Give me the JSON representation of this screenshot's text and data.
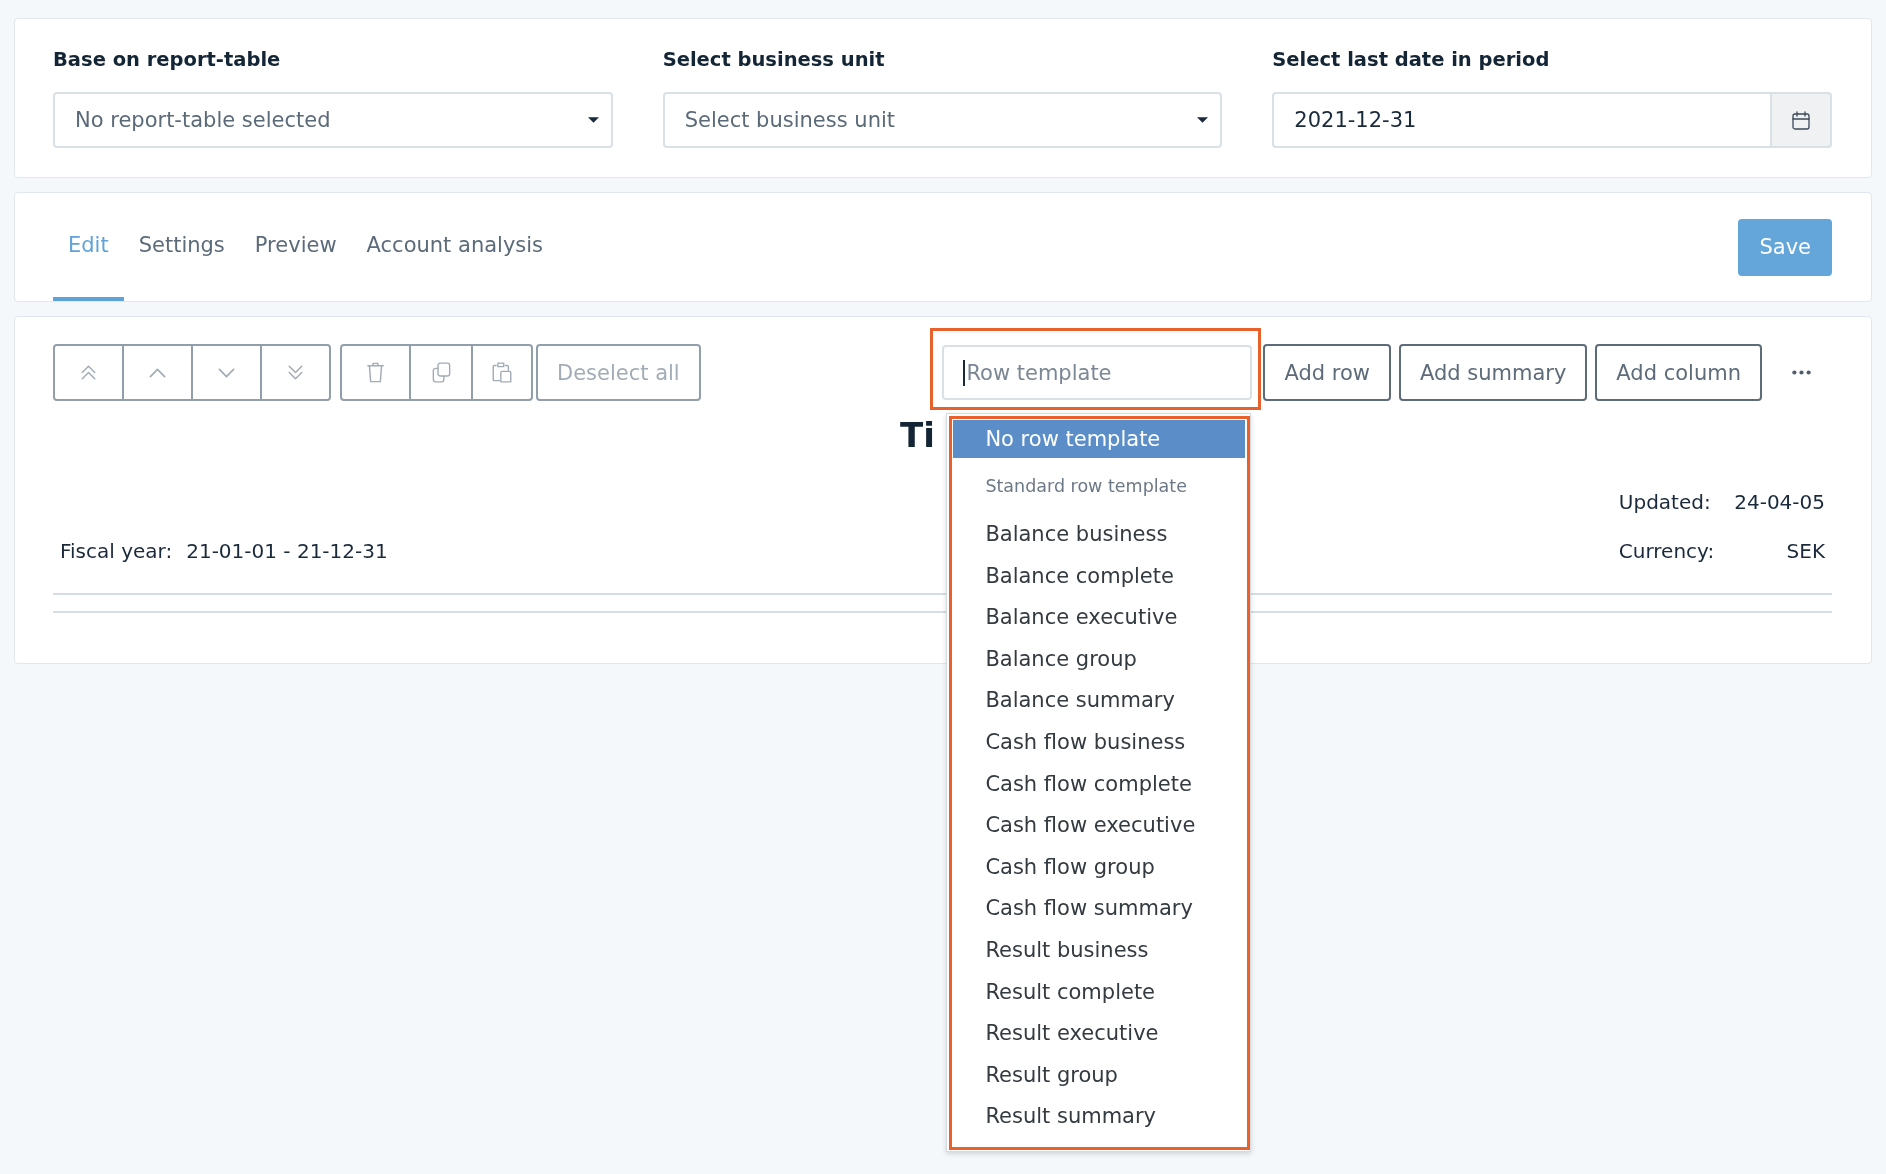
{
  "filters": [
    {
      "kind": "select",
      "label": "Base on report-table",
      "value": "No report-table selected"
    },
    {
      "kind": "select",
      "label": "Select business unit",
      "placeholder": "Select business unit"
    },
    {
      "kind": "date",
      "label": "Select last date in period",
      "value": "2021-12-31"
    }
  ],
  "tabs": [
    {
      "label": "Edit",
      "selected": true
    },
    {
      "label": "Settings",
      "selected": false
    },
    {
      "label": "Preview",
      "selected": false
    },
    {
      "label": "Account analysis",
      "selected": false
    }
  ],
  "save_button": {
    "label": "Save"
  },
  "toolbar": {
    "edit_groups": [
      {
        "buttons": [
          {
            "kind": "move-top",
            "disabled": true
          },
          {
            "kind": "move-up",
            "disabled": true
          },
          {
            "kind": "move-down",
            "disabled": true
          },
          {
            "kind": "move-bottom",
            "disabled": true
          }
        ]
      },
      {
        "buttons": [
          {
            "kind": "delete",
            "disabled": true
          },
          {
            "kind": "copy",
            "disabled": true
          },
          {
            "kind": "paste",
            "disabled": true
          }
        ]
      }
    ],
    "deselect_button": {
      "label": "Deselect all",
      "disabled": true
    },
    "row_template": {
      "placeholder": "Row template",
      "focused": true,
      "highlighted": true
    },
    "action_buttons": [
      {
        "label": "Add row",
        "disabled": false
      },
      {
        "label": "Add summary",
        "disabled": false
      },
      {
        "label": "Add column",
        "disabled": false
      }
    ]
  },
  "report": {
    "title": "Ti",
    "fiscal_year": {
      "label": "Fiscal year:",
      "value": "21-01-01 - 21-12-31"
    },
    "details": [
      {
        "label": "Updated:",
        "value": "24-04-05"
      },
      {
        "label": "Currency:",
        "value": "SEK"
      }
    ]
  },
  "row_template_menu": {
    "highlighted": true,
    "options": [
      {
        "label": "No row template",
        "selected": true
      }
    ],
    "groups": [
      {
        "label": "Standard row template",
        "options": [
          {
            "label": "Balance business",
            "selected": false
          },
          {
            "label": "Balance complete",
            "selected": false
          },
          {
            "label": "Balance executive",
            "selected": false
          },
          {
            "label": "Balance group",
            "selected": false
          },
          {
            "label": "Balance summary",
            "selected": false
          },
          {
            "label": "Cash flow business",
            "selected": false
          },
          {
            "label": "Cash flow complete",
            "selected": false
          },
          {
            "label": "Cash flow executive",
            "selected": false
          },
          {
            "label": "Cash flow group",
            "selected": false
          },
          {
            "label": "Cash flow summary",
            "selected": false
          },
          {
            "label": "Result business",
            "selected": false
          },
          {
            "label": "Result complete",
            "selected": false
          },
          {
            "label": "Result executive",
            "selected": false
          },
          {
            "label": "Result group",
            "selected": false
          },
          {
            "label": "Result summary",
            "selected": false
          }
        ]
      }
    ]
  }
}
